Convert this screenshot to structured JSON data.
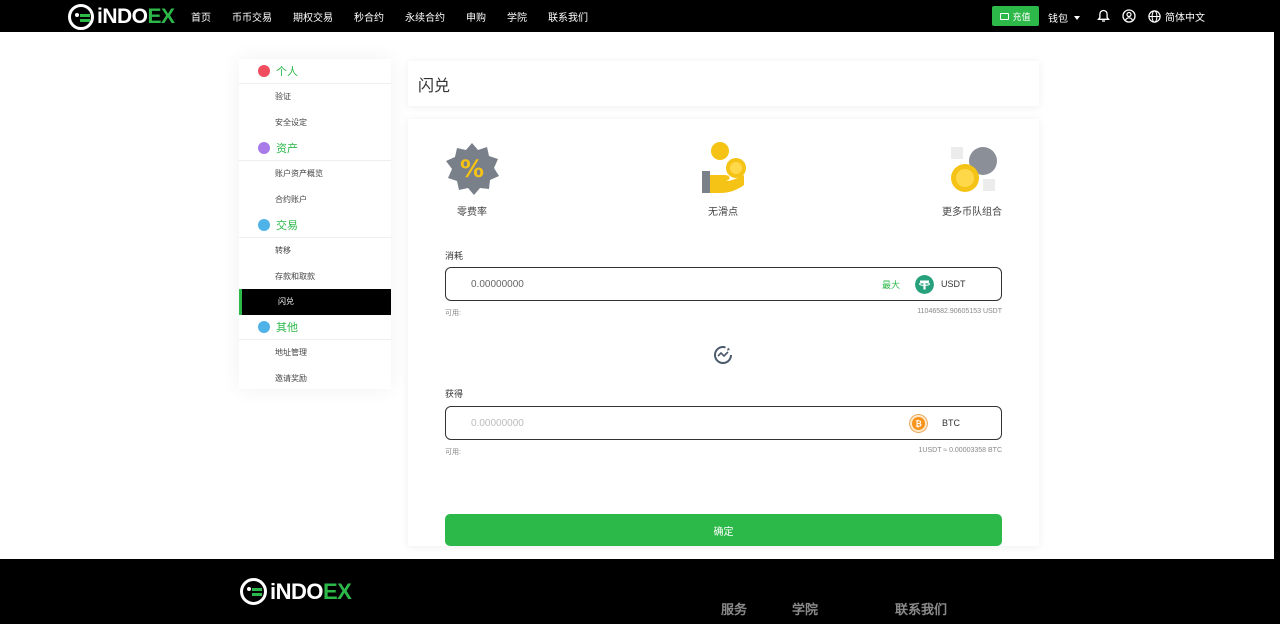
{
  "brand": {
    "logo_text_main": "iNDO",
    "logo_text_accent": "EX"
  },
  "nav": [
    "首页",
    "币币交易",
    "期权交易",
    "秒合约",
    "永续合约",
    "申购",
    "学院",
    "联系我们"
  ],
  "header_right": {
    "deposit_label": "充值",
    "wallet_label": "钱包",
    "language_label": "简体中文"
  },
  "sidebar": {
    "sections": [
      {
        "title": "个人",
        "items": [
          "验证",
          "安全设定"
        ]
      },
      {
        "title": "资产",
        "items": [
          "账户资产概览",
          "合约账户"
        ]
      },
      {
        "title": "交易",
        "items": [
          "转移",
          "存款和取款",
          "闪兑"
        ]
      },
      {
        "title": "其他",
        "items": [
          "地址管理",
          "邀请奖励"
        ]
      }
    ],
    "active_item": "闪兑"
  },
  "page_title": "闪兑",
  "features": [
    "零费率",
    "无滑点",
    "更多币队组合"
  ],
  "swap": {
    "from_label": "消耗",
    "from_value": "0.00000000",
    "max_label": "最大",
    "from_coin": "USDT",
    "from_available_label": "可用:",
    "from_available_value": "11046582.90605153 USDT",
    "to_label": "获得",
    "to_placeholder": "0.00000000",
    "to_coin": "BTC",
    "to_available_label": "可用:",
    "rate": "1USDT ≈ 0.00003358 BTC",
    "confirm_label": "确定"
  },
  "footer": {
    "columns": [
      "服务",
      "学院",
      "联系我们"
    ]
  },
  "colors": {
    "accent": "#2db84a",
    "header_bg": "#000000",
    "usdt": "#26a17b",
    "btc": "#f7931a"
  }
}
